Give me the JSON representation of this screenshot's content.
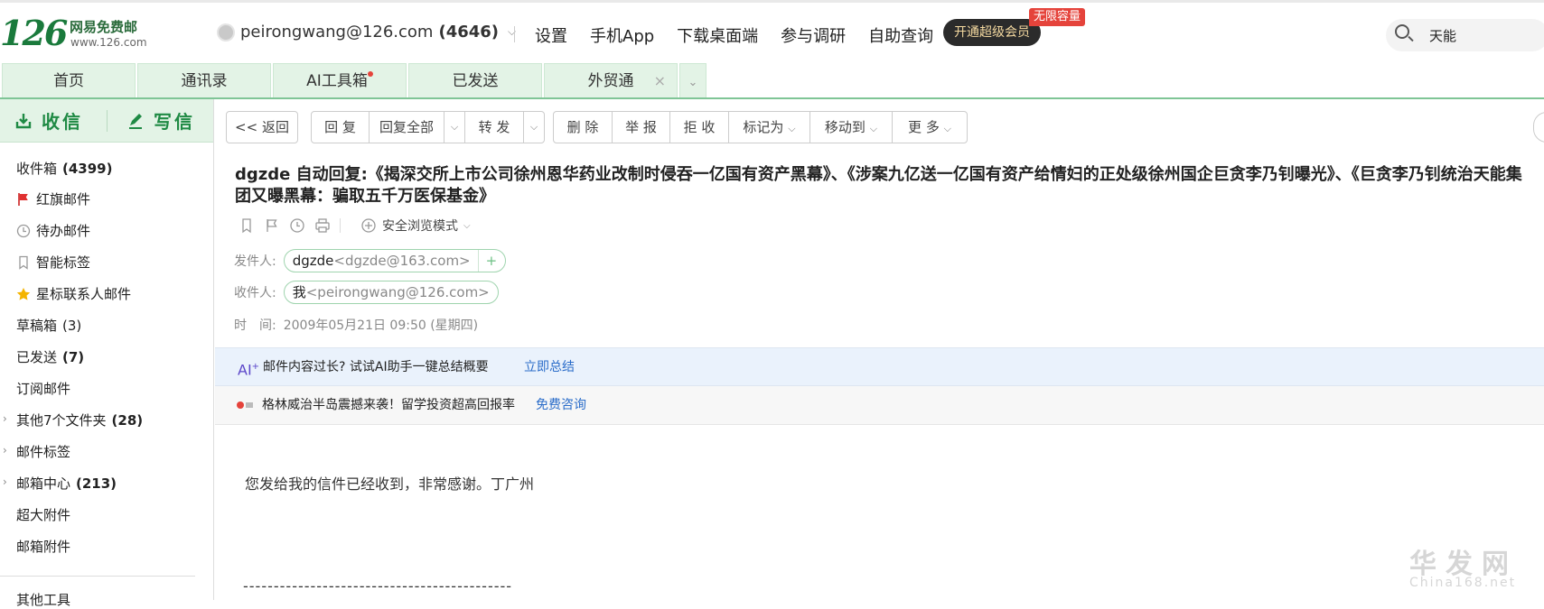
{
  "header": {
    "logo_number": "126",
    "logo_name": "网易免费邮",
    "logo_domain": "www.126.com",
    "account_email": "peirongwang@126.com",
    "account_count": "(4646)",
    "nav": [
      "设置",
      "手机App",
      "下载桌面端",
      "参与调研",
      "自助查询"
    ],
    "vip_button": "开通超级会员",
    "vip_badge": "无限容量",
    "search_value": "天能"
  },
  "tabs": {
    "home": "首页",
    "contacts": "通讯录",
    "ai_tools": "AI工具箱",
    "sent": "已发送",
    "foreign_trade": "外贸通",
    "close": "×",
    "more": "⌄"
  },
  "sidebar": {
    "receive": "收信",
    "write": "写信",
    "inbox": "收件箱",
    "inbox_count": "(4399)",
    "red_flag": "红旗邮件",
    "todo": "待办邮件",
    "smart_tags": "智能标签",
    "star_contacts": "星标联系人邮件",
    "drafts": "草稿箱",
    "drafts_count": "(3)",
    "sent": "已发送",
    "sent_count": "(7)",
    "subscriptions": "订阅邮件",
    "other_folders": "其他7个文件夹",
    "other_folders_count": "(28)",
    "mail_tags": "邮件标签",
    "mail_center": "邮箱中心",
    "mail_center_count": "(213)",
    "large_attachments": "超大附件",
    "attachments": "邮箱附件",
    "more_tools": "其他工具"
  },
  "toolbar": {
    "back": "<< 返回",
    "reply": "回 复",
    "reply_all": "回复全部",
    "forward": "转 发",
    "delete": "删 除",
    "report": "举 报",
    "reject": "拒 收",
    "mark_as": "标记为",
    "move_to": "移动到",
    "more": "更 多"
  },
  "message": {
    "subject": "dgzde 自动回复:《揭深交所上市公司徐州恩华药业改制时侵吞一亿国有资产黑幕》、《涉案九亿送一亿国有资产给情妇的正处级徐州国企巨贪李乃钊曝光》、《巨贪李乃钊统治天能集团又曝黑幕：骗取五千万医保基金》",
    "safe_mode": "安全浏览模式",
    "from_label": "发件人:",
    "from_name": "dgzde",
    "from_addr": "<dgzde@163.com>",
    "to_label": "收件人:",
    "to_name": "我",
    "to_addr": "<peirongwang@126.com>",
    "time_label": "时　间:",
    "time_value": "2009年05月21日 09:50 (星期四)",
    "ai_tip": "邮件内容过长? 试试AI助手一键总结概要",
    "ai_link": "立即总结",
    "ad_text": "格林威治半岛震撼来袭！留学投资超高回报率",
    "ad_link": "免费咨询",
    "body": "您发给我的信件已经收到，非常感谢。丁广州",
    "separator": "--------------------------------------------"
  },
  "watermark": {
    "cn": "华发网",
    "en": "China168.net"
  },
  "colors": {
    "brand_green": "#1f8a44",
    "tab_bg": "#e3f3e6",
    "link_blue": "#2a6cc9",
    "badge_red": "#e5433b"
  }
}
